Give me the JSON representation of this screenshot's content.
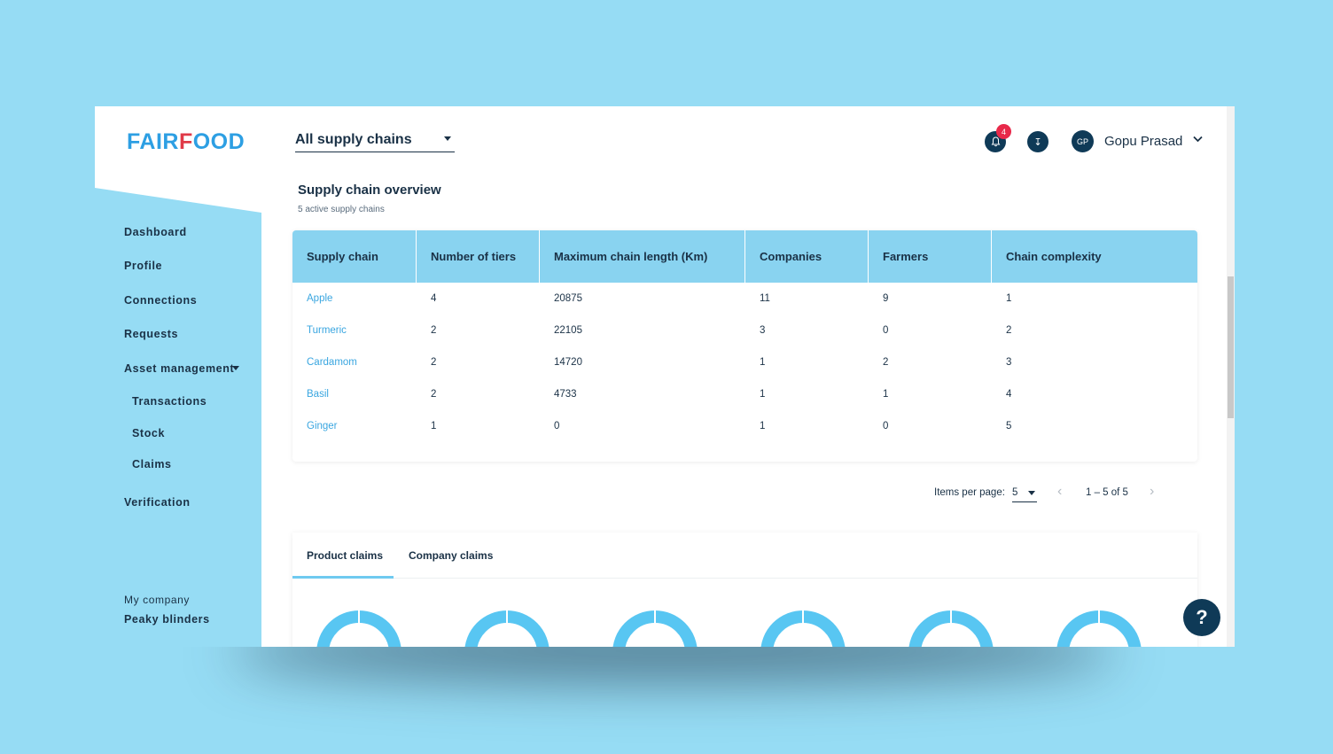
{
  "app": {
    "logo_part1": "FAIR",
    "logo_f": "F",
    "logo_part2": "OOD"
  },
  "header": {
    "supply_chain_select": "All supply chains",
    "notification_count": "4",
    "download_icon": "↧",
    "user_initials": "GP",
    "user_name": "Gopu Prasad"
  },
  "sidebar": {
    "items": [
      "Dashboard",
      "Profile",
      "Connections",
      "Requests",
      "Asset management",
      "Transactions",
      "Stock",
      "Claims",
      "Verification"
    ],
    "company_label": "My company",
    "company_name": "Peaky blinders"
  },
  "overview": {
    "title": "Supply chain overview",
    "subtitle": "5 active supply chains"
  },
  "table": {
    "headers": [
      "Supply chain",
      "Number of tiers",
      "Maximum chain length (Km)",
      "Companies",
      "Farmers",
      "Chain complexity"
    ],
    "rows": [
      [
        "Apple",
        "4",
        "20875",
        "11",
        "9",
        "1"
      ],
      [
        "Turmeric",
        "2",
        "22105",
        "3",
        "0",
        "2"
      ],
      [
        "Cardamom",
        "2",
        "14720",
        "1",
        "2",
        "3"
      ],
      [
        "Basil",
        "2",
        "4733",
        "1",
        "1",
        "4"
      ],
      [
        "Ginger",
        "1",
        "0",
        "1",
        "0",
        "5"
      ]
    ]
  },
  "pagination": {
    "label": "Items per page:",
    "per_page": "5",
    "range": "1 – 5 of 5",
    "prev": "‹",
    "next": "›"
  },
  "claims": {
    "tabs": [
      "Product claims",
      "Company claims"
    ],
    "active_tab": "Product claims"
  },
  "help": {
    "label": "?"
  },
  "colors": {
    "background": "#96dcf4",
    "accent": "#58c6f2",
    "dark": "#0f3a57",
    "badge": "#e8294a",
    "link": "#3aa6e0"
  }
}
